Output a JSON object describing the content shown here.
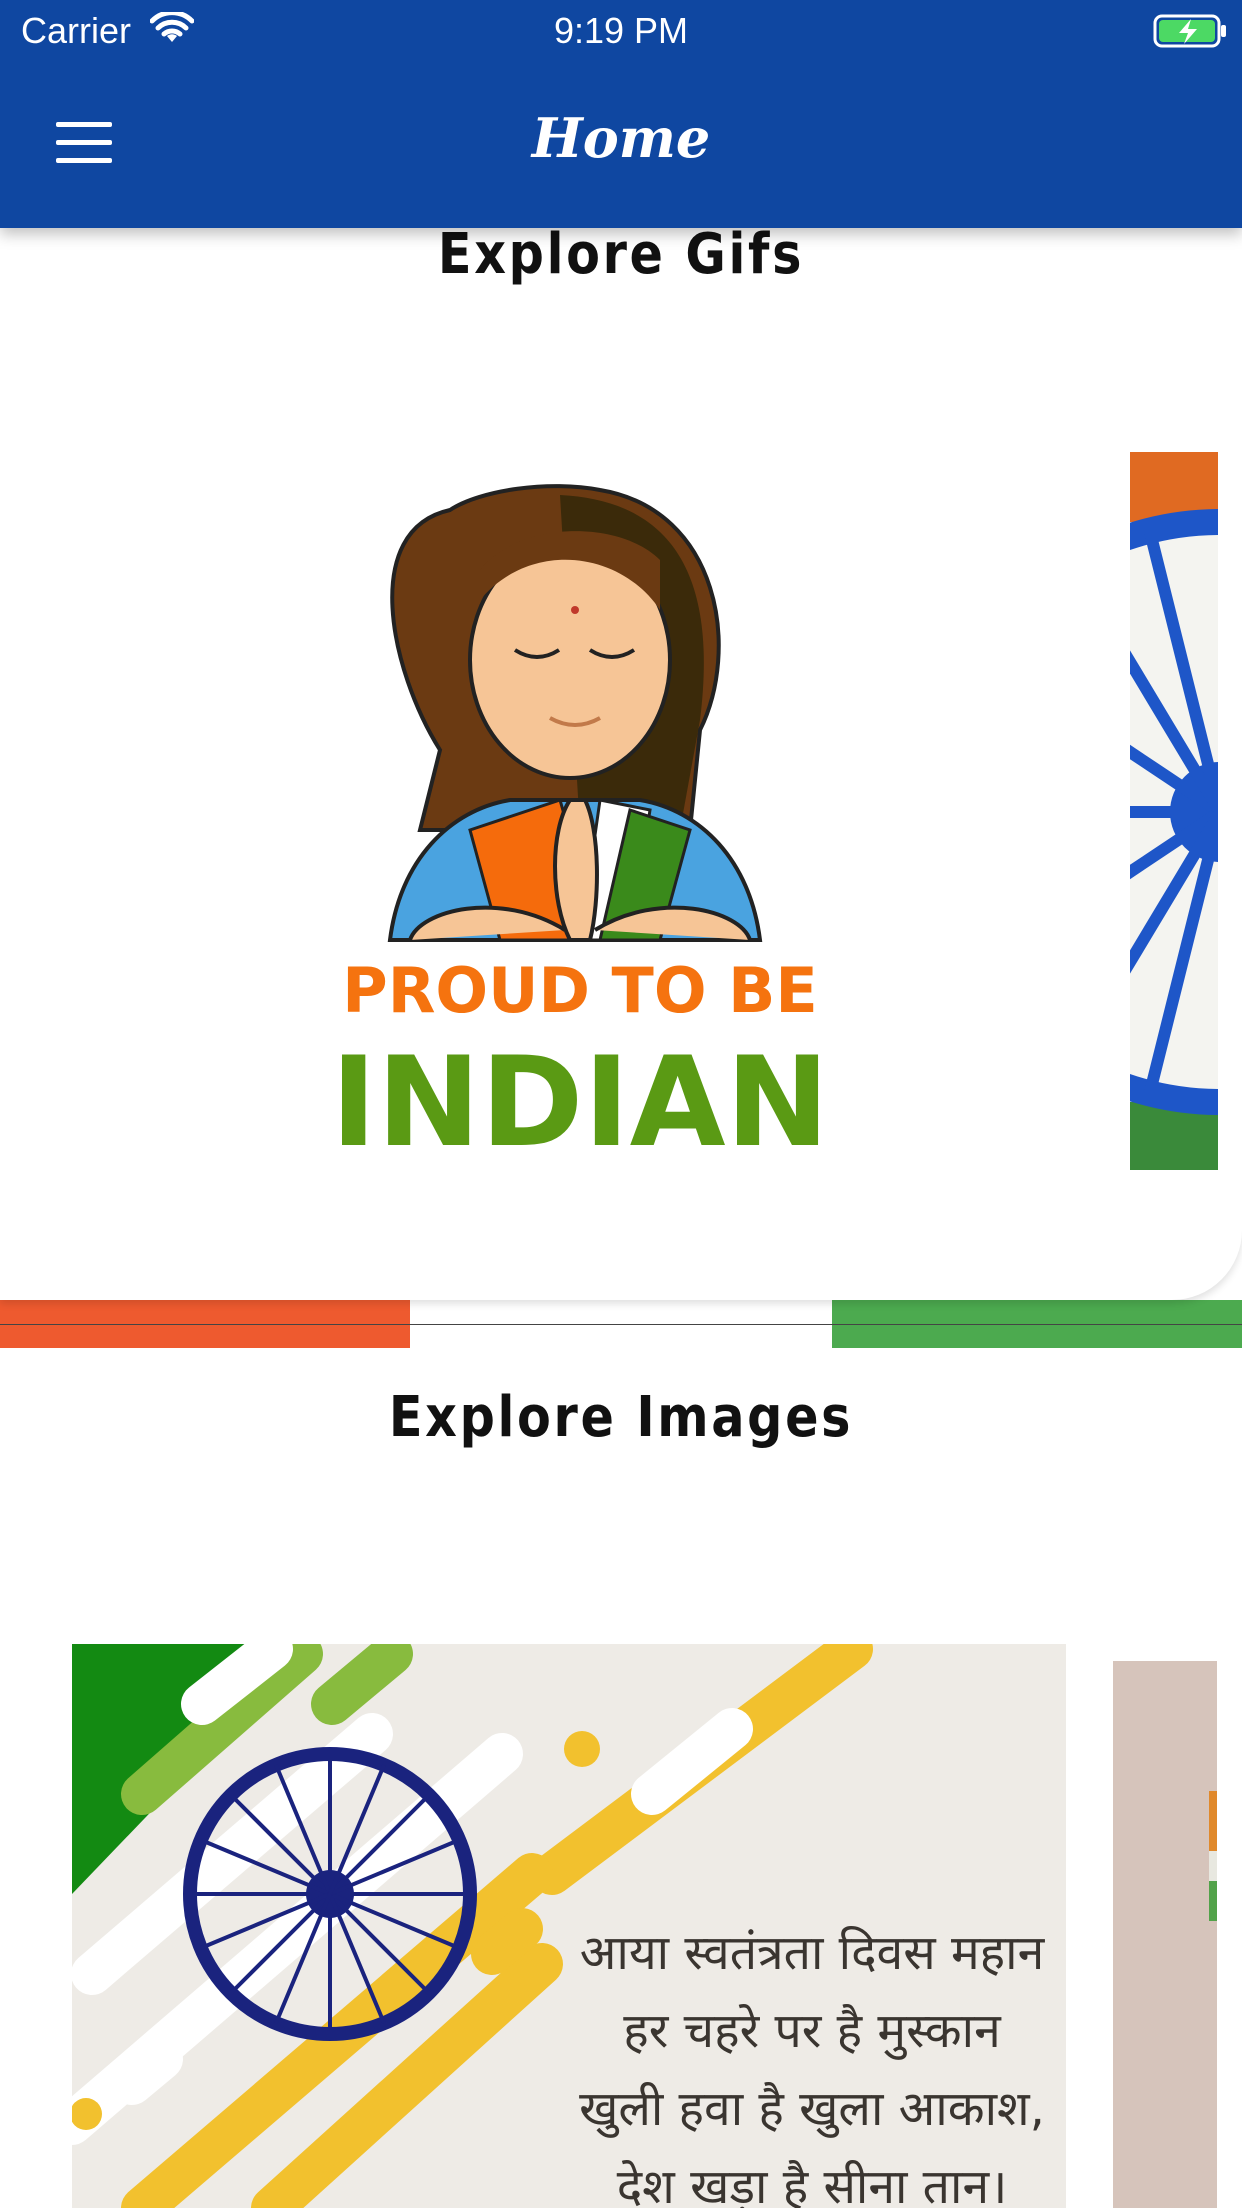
{
  "status_bar": {
    "carrier": "Carrier",
    "time": "9:19 PM"
  },
  "nav": {
    "title": "Home"
  },
  "sections": {
    "gifs_title": "Explore Gifs",
    "images_title": "Explore Images"
  },
  "gif_card": {
    "line1": "PROUD TO BE",
    "line2": "INDIAN"
  },
  "image_card": {
    "poem": [
      "आया स्वतंत्रता दिवस महान",
      "हर चहरे पर है मुस्कान",
      "खुली हवा है खुला आकाश,",
      "देश खड़ा है सीना तान।"
    ]
  },
  "colors": {
    "nav_blue": "#0f47a1",
    "saffron": "#ee5a2f",
    "green": "#4caa4f",
    "chakra_blue": "#1a237e"
  }
}
